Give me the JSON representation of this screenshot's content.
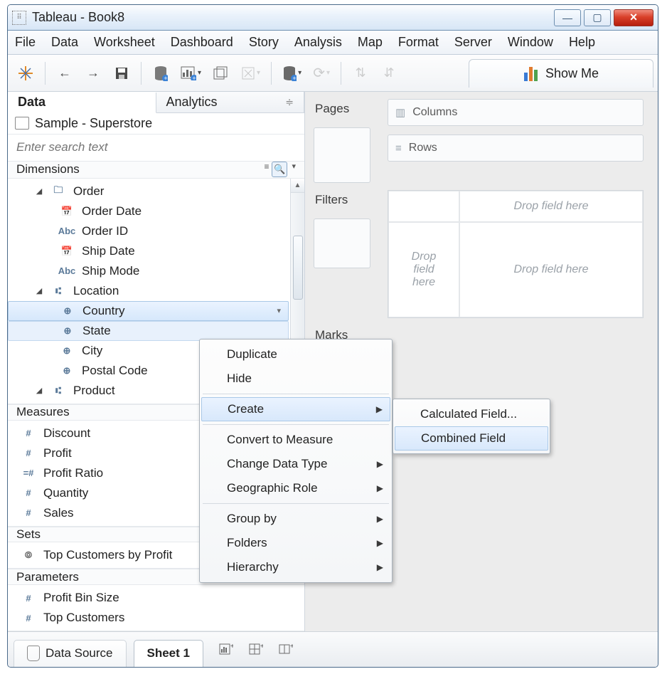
{
  "window": {
    "title": "Tableau - Book8"
  },
  "menubar": [
    "File",
    "Data",
    "Worksheet",
    "Dashboard",
    "Story",
    "Analysis",
    "Map",
    "Format",
    "Server",
    "Window",
    "Help"
  ],
  "toolbar": {
    "showme_label": "Show Me"
  },
  "sidepane": {
    "tabs": {
      "data": "Data",
      "analytics": "Analytics"
    },
    "datasource": "Sample - Superstore",
    "search_placeholder": "Enter search text",
    "dimensions_label": "Dimensions",
    "measures_label": "Measures",
    "sets_label": "Sets",
    "parameters_label": "Parameters",
    "dimensions": {
      "order_folder": "Order",
      "order_date": "Order Date",
      "order_id": "Order ID",
      "ship_date": "Ship Date",
      "ship_mode": "Ship Mode",
      "location_hier": "Location",
      "country": "Country",
      "state": "State",
      "city": "City",
      "postal_code": "Postal Code",
      "product_hier": "Product"
    },
    "measures": [
      "Discount",
      "Profit",
      "Profit Ratio",
      "Quantity",
      "Sales"
    ],
    "sets": [
      "Top Customers by Profit"
    ],
    "parameters": [
      "Profit Bin Size",
      "Top Customers"
    ]
  },
  "shelves": {
    "pages": "Pages",
    "filters": "Filters",
    "marks": "Marks",
    "columns": "Columns",
    "rows": "Rows",
    "mark_type": "Abc",
    "drop_here": "Drop field here",
    "drop_here_multi": "Drop field here"
  },
  "statusbar": {
    "data_source": "Data Source",
    "sheet": "Sheet 1"
  },
  "context_menu": {
    "duplicate": "Duplicate",
    "hide": "Hide",
    "create": "Create",
    "convert": "Convert to Measure",
    "change_type": "Change Data Type",
    "geo_role": "Geographic Role",
    "group_by": "Group by",
    "folders": "Folders",
    "hierarchy": "Hierarchy"
  },
  "submenu": {
    "calc_field": "Calculated Field...",
    "combined_field": "Combined Field"
  }
}
